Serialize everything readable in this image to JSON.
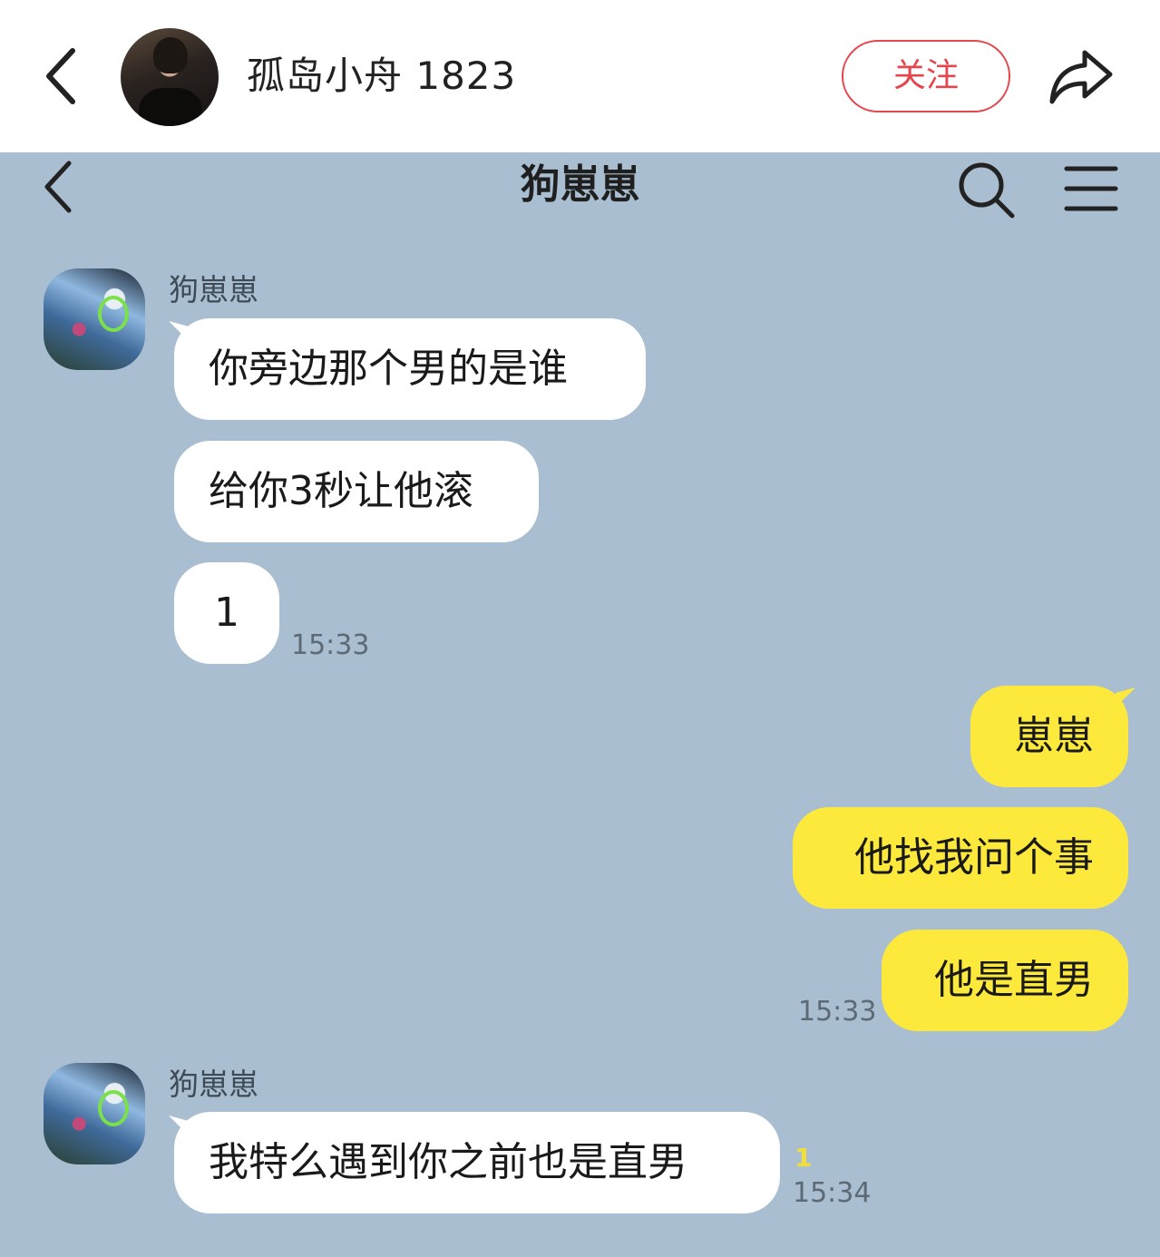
{
  "header": {
    "username": "孤岛小舟 1823",
    "follow_label": "关注",
    "icons": [
      "back-arrow-icon",
      "avatar",
      "share-icon"
    ]
  },
  "chat": {
    "title": "狗崽崽",
    "icons": [
      "back-arrow-icon",
      "search-icon",
      "menu-icon"
    ],
    "background": "#a9bed0",
    "incoming_bubble_color": "#ffffff",
    "outgoing_bubble_color": "#fde93c",
    "groups": [
      {
        "sender": "狗崽崽",
        "direction": "incoming",
        "messages": [
          "你旁边那个男的是谁",
          "给你3秒让他滚",
          "1"
        ],
        "time": "15:33"
      },
      {
        "sender": "",
        "direction": "outgoing",
        "messages": [
          "崽崽",
          "他找我问个事",
          "他是直男"
        ],
        "time": "15:33"
      },
      {
        "sender": "狗崽崽",
        "direction": "incoming",
        "messages": [
          "我特么遇到你之前也是直男"
        ],
        "unread": "1",
        "time": "15:34"
      }
    ]
  }
}
